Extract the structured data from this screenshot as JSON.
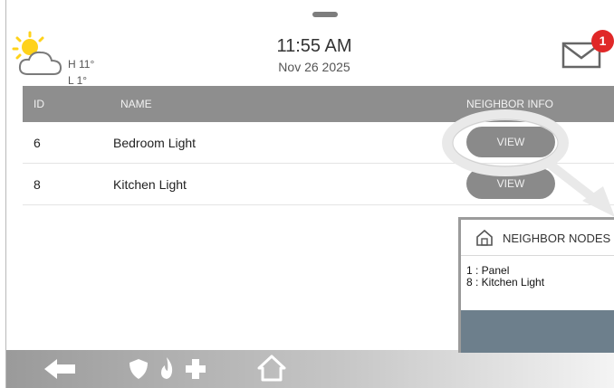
{
  "header": {
    "temp_high": "H 11°",
    "temp_low": "L 1°",
    "time": "11:55 AM",
    "date": "Nov 26 2025",
    "message_count": "1"
  },
  "table": {
    "columns": {
      "id": "ID",
      "name": "NAME",
      "neighbor_info": "NEIGHBOR INFO"
    },
    "rows": [
      {
        "id": "6",
        "name": "Bedroom Light",
        "action": "VIEW"
      },
      {
        "id": "8",
        "name": "Kitchen Light",
        "action": "VIEW"
      }
    ]
  },
  "popup": {
    "title": "NEIGHBOR NODES F",
    "lines": [
      "1 : Panel",
      "8 : Kitchen Light"
    ]
  },
  "icons": {
    "weather": "partly-sunny-icon",
    "mail": "envelope-icon",
    "back": "back-arrow-icon",
    "security": "shield-icon",
    "fire": "fire-icon",
    "medical": "medical-cross-icon",
    "home": "home-icon",
    "popup": "house-icon"
  },
  "colors": {
    "header_bar": "#8e8e8e",
    "button": "#8a8a8a",
    "badge": "#e02828",
    "popup_footer": "#6d7f8c"
  }
}
